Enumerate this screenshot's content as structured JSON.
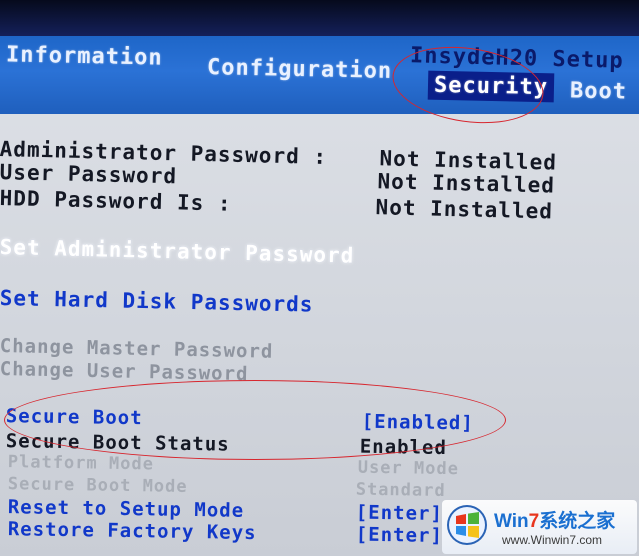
{
  "header": {
    "setup_title": "InsydeH20 Setup",
    "tabs": [
      {
        "label": "Information",
        "active": false
      },
      {
        "label": "Configuration",
        "active": false
      },
      {
        "label": "Security",
        "active": true
      },
      {
        "label": "Boot",
        "active": false
      }
    ]
  },
  "security": {
    "admin_password": {
      "label": "Administrator Password :",
      "value": "Not Installed"
    },
    "user_password": {
      "label": "User Password",
      "value": "Not Installed"
    },
    "hdd_password": {
      "label": "HDD Password Is :",
      "value": "Not Installed"
    },
    "set_admin_password": "Set Administrator Password",
    "set_hdd_passwords": "Set Hard Disk Passwords",
    "change_master_password": "Change Master Password",
    "change_user_password": "Change User Password",
    "secure_boot": {
      "label": "Secure Boot",
      "value": "[Enabled]"
    },
    "secure_boot_status": {
      "label": "Secure Boot Status",
      "value": "Enabled"
    },
    "platform_mode": {
      "label": "Platform Mode",
      "value": "User Mode"
    },
    "secure_boot_mode": {
      "label": "Secure Boot Mode",
      "value": "Standard"
    },
    "reset_setup_mode": {
      "label": "Reset to Setup Mode",
      "value": "[Enter]"
    },
    "restore_factory_keys": {
      "label": "Restore Factory Keys",
      "value": "[Enter]"
    }
  },
  "watermark": {
    "brand_prefix": "Win",
    "brand_seven": "7",
    "brand_suffix": "系统之家",
    "url": "www.Winwin7.com"
  },
  "colors": {
    "menu_bar": "#2b72d6",
    "active_tab": "#0a1f8a",
    "link_blue": "#1138c9",
    "annotation_red": "#d7262e"
  }
}
